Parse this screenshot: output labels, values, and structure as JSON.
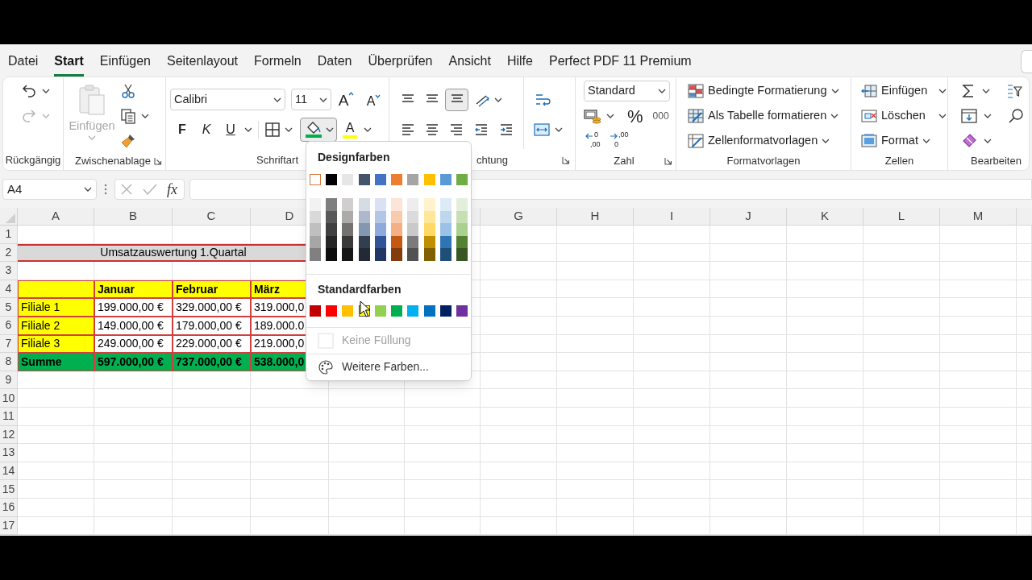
{
  "menu_tabs": [
    {
      "label": "Datei",
      "selected": false
    },
    {
      "label": "Start",
      "selected": true
    },
    {
      "label": "Einfügen",
      "selected": false
    },
    {
      "label": "Seitenlayout",
      "selected": false
    },
    {
      "label": "Formeln",
      "selected": false
    },
    {
      "label": "Daten",
      "selected": false
    },
    {
      "label": "Überprüfen",
      "selected": false
    },
    {
      "label": "Ansicht",
      "selected": false
    },
    {
      "label": "Hilfe",
      "selected": false
    },
    {
      "label": "Perfect PDF 11 Premium",
      "selected": false
    }
  ],
  "ribbon": {
    "undo": {
      "label": "Rückgängig"
    },
    "clipboard": {
      "paste": "Einfügen",
      "label": "Zwischenablage"
    },
    "font": {
      "name": "Calibri",
      "size": "11",
      "grow": "A",
      "shrink": "A",
      "bold": "F",
      "italic": "K",
      "underline": "U",
      "font_color": "A",
      "label": "Schriftart"
    },
    "alignment": {
      "label": "chtung"
    },
    "number": {
      "format": "Standard",
      "percent": "%",
      "thousands": "000",
      "increase_decimals": [
        "0",
        ",00"
      ],
      "decrease_decimals": [
        ",00",
        "0"
      ],
      "label": "Zahl"
    },
    "styles": {
      "items": [
        "Bedingte Formatierung",
        "Als Tabelle formatieren",
        "Zellenformatvorlagen"
      ],
      "label": "Formatvorlagen"
    },
    "cells": {
      "items": [
        "Einfügen",
        "Löschen",
        "Format"
      ],
      "label": "Zellen"
    },
    "editing": {
      "label": "Bearbeiten"
    }
  },
  "formula_bar": {
    "name_box": "A4",
    "function": "fx"
  },
  "columns": [
    {
      "label": "A"
    },
    {
      "label": "B"
    },
    {
      "label": "C"
    },
    {
      "label": "D"
    },
    {},
    {},
    {
      "label": "G"
    },
    {
      "label": "H"
    },
    {
      "label": "I"
    },
    {
      "label": "J"
    },
    {
      "label": "K"
    },
    {
      "label": "L"
    },
    {
      "label": "M"
    }
  ],
  "rows": [
    {
      "label": "1"
    },
    {
      "label": "2",
      "cells": [
        {
          "kind": "title",
          "text": "Umsatzauswertung 1.Quartal"
        }
      ]
    },
    {
      "label": "3"
    },
    {
      "label": "4",
      "cells": [
        {
          "kind": "header"
        },
        {
          "kind": "header",
          "text": "Januar"
        },
        {
          "kind": "header",
          "text": "Februar"
        },
        {
          "kind": "header",
          "text": "März"
        }
      ]
    },
    {
      "label": "5",
      "cells": [
        {
          "kind": "label",
          "text": "Filiale 1"
        },
        {
          "kind": "value",
          "text": "199.000,00 €"
        },
        {
          "kind": "value",
          "text": "329.000,00 €"
        },
        {
          "kind": "value",
          "text": "319.000,0"
        }
      ]
    },
    {
      "label": "6",
      "cells": [
        {
          "kind": "label",
          "text": "Filiale 2"
        },
        {
          "kind": "value",
          "text": "149.000,00 €"
        },
        {
          "kind": "value",
          "text": "179.000,00 €"
        },
        {
          "kind": "value",
          "text": "189.000.0"
        }
      ]
    },
    {
      "label": "7",
      "cells": [
        {
          "kind": "label",
          "text": "Filiale 3"
        },
        {
          "kind": "value",
          "text": "249.000,00 €"
        },
        {
          "kind": "value",
          "text": "229.000,00 €"
        },
        {
          "kind": "value",
          "text": "219.000,0"
        }
      ]
    },
    {
      "label": "8",
      "cells": [
        {
          "kind": "total",
          "text": "Summe"
        },
        {
          "kind": "total",
          "text": "597.000,00 €"
        },
        {
          "kind": "total",
          "text": "737.000,00 €"
        },
        {
          "kind": "total",
          "text": "538.000,0"
        }
      ]
    },
    {
      "label": "9"
    },
    {
      "label": "10"
    },
    {
      "label": "11"
    },
    {
      "label": "12"
    },
    {
      "label": "13"
    },
    {
      "label": "14"
    },
    {
      "label": "15"
    },
    {
      "label": "16"
    },
    {
      "label": "17"
    }
  ],
  "fill_menu": {
    "theme_title": "Designfarben",
    "theme_colors": [
      {
        "color": "#ffffff",
        "selected": true
      },
      {
        "color": "#000000",
        "selected": false
      },
      {
        "color": "#e7e6e6",
        "selected": false
      },
      {
        "color": "#44546a",
        "selected": false
      },
      {
        "color": "#4472c4",
        "selected": false
      },
      {
        "color": "#ed7d31",
        "selected": false
      },
      {
        "color": "#a5a5a5",
        "selected": false
      },
      {
        "color": "#ffc000",
        "selected": false
      },
      {
        "color": "#5b9bd5",
        "selected": false
      },
      {
        "color": "#70ad47",
        "selected": false
      }
    ],
    "shades": [
      {
        "cells": [
          {
            "color": "#f2f2f2"
          },
          {
            "color": "#d9d9d9"
          },
          {
            "color": "#bfbfbf"
          },
          {
            "color": "#a6a6a6"
          },
          {
            "color": "#808080"
          }
        ]
      },
      {
        "cells": [
          {
            "color": "#7f7f7f"
          },
          {
            "color": "#595959"
          },
          {
            "color": "#404040"
          },
          {
            "color": "#262626"
          },
          {
            "color": "#0d0d0d"
          }
        ]
      },
      {
        "cells": [
          {
            "color": "#d0cece"
          },
          {
            "color": "#aeaaaa"
          },
          {
            "color": "#757171"
          },
          {
            "color": "#3a3838"
          },
          {
            "color": "#161616"
          }
        ]
      },
      {
        "cells": [
          {
            "color": "#d6dce4"
          },
          {
            "color": "#adb9ca"
          },
          {
            "color": "#8497b0"
          },
          {
            "color": "#333f4f"
          },
          {
            "color": "#222b35"
          }
        ]
      },
      {
        "cells": [
          {
            "color": "#d9e1f2"
          },
          {
            "color": "#b4c6e7"
          },
          {
            "color": "#8ea9db"
          },
          {
            "color": "#305496"
          },
          {
            "color": "#203764"
          }
        ]
      },
      {
        "cells": [
          {
            "color": "#fce4d6"
          },
          {
            "color": "#f8cbad"
          },
          {
            "color": "#f4b084"
          },
          {
            "color": "#c65911"
          },
          {
            "color": "#833c0c"
          }
        ]
      },
      {
        "cells": [
          {
            "color": "#ededed"
          },
          {
            "color": "#dbdbdb"
          },
          {
            "color": "#c9c9c9"
          },
          {
            "color": "#7b7b7b"
          },
          {
            "color": "#525252"
          }
        ]
      },
      {
        "cells": [
          {
            "color": "#fff2cc"
          },
          {
            "color": "#ffe699"
          },
          {
            "color": "#ffd966"
          },
          {
            "color": "#bf8f00"
          },
          {
            "color": "#806000"
          }
        ]
      },
      {
        "cells": [
          {
            "color": "#ddebf7"
          },
          {
            "color": "#bdd7ee"
          },
          {
            "color": "#9bc2e6"
          },
          {
            "color": "#2f75b5"
          },
          {
            "color": "#1f4e78"
          }
        ]
      },
      {
        "cells": [
          {
            "color": "#e2efda"
          },
          {
            "color": "#c6e0b4"
          },
          {
            "color": "#a9d08e"
          },
          {
            "color": "#548235"
          },
          {
            "color": "#375623"
          }
        ]
      }
    ],
    "standard_title": "Standardfarben",
    "standard_colors": [
      {
        "color": "#c00000",
        "hovered": false
      },
      {
        "color": "#ff0000",
        "hovered": false
      },
      {
        "color": "#ffc000",
        "hovered": false
      },
      {
        "color": "#ffff00",
        "hovered": true
      },
      {
        "color": "#92d050",
        "hovered": false
      },
      {
        "color": "#00b050",
        "hovered": false
      },
      {
        "color": "#00b0f0",
        "hovered": false
      },
      {
        "color": "#0070c0",
        "hovered": false
      },
      {
        "color": "#002060",
        "hovered": false
      },
      {
        "color": "#7030a0",
        "hovered": false
      }
    ],
    "actions": [
      {
        "kind": "no_fill",
        "label": "Keine Füllung",
        "disabled": true
      },
      {
        "kind": "more_colors",
        "label": "Weitere Farben...",
        "disabled": false
      }
    ]
  }
}
